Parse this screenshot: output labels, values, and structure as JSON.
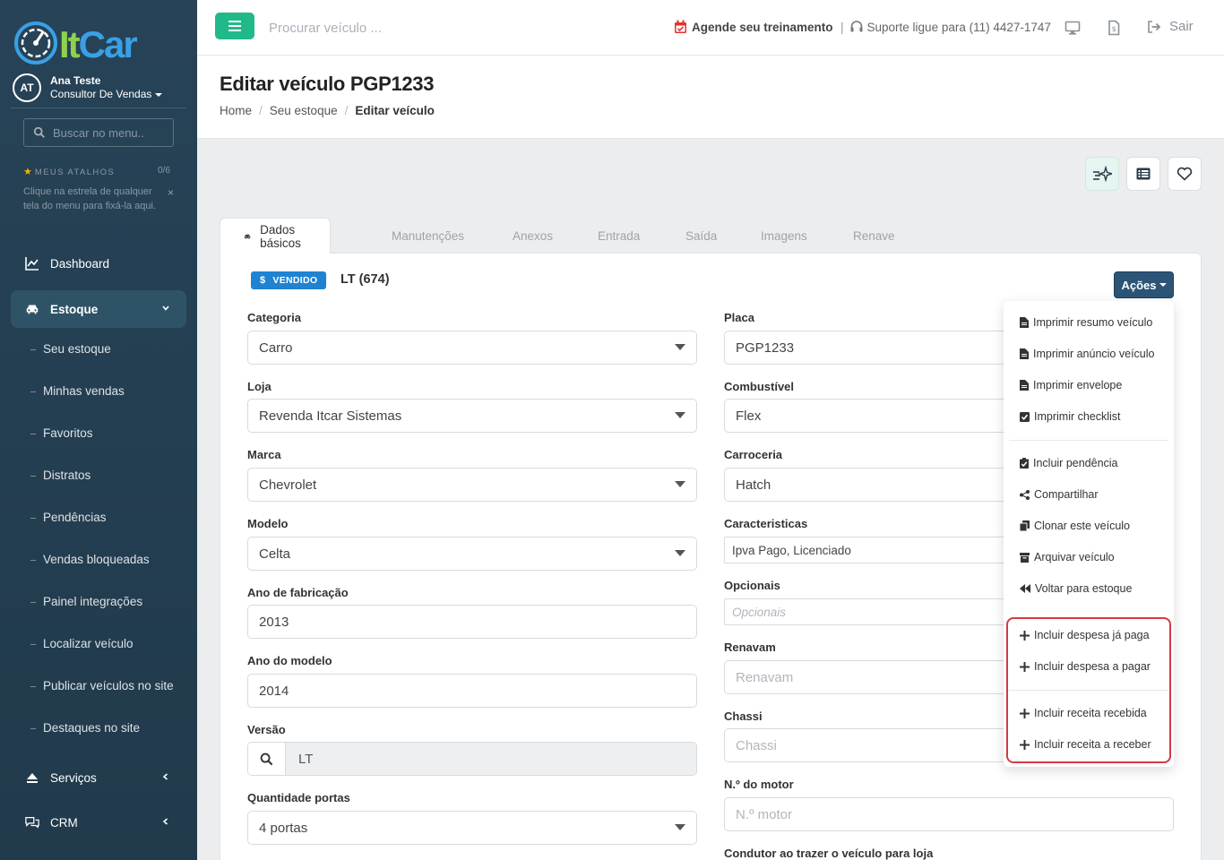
{
  "app": {
    "logo_text_a": "It",
    "logo_text_b": "Car"
  },
  "user": {
    "initials": "AT",
    "name": "Ana Teste",
    "role": "Consultor De Vendas"
  },
  "sidebar": {
    "search_placeholder": "Buscar no menu..",
    "shortcuts_title": "MEUS ATALHOS",
    "shortcuts_count": "0/6",
    "shortcuts_hint": "Clique na estrela de qualquer tela do menu para fixá-la aqui.",
    "nav": [
      {
        "label": "Dashboard"
      },
      {
        "label": "Estoque"
      },
      {
        "label": "Serviços"
      },
      {
        "label": "CRM"
      }
    ],
    "estoque_subitems": [
      {
        "label": "Seu estoque"
      },
      {
        "label": "Minhas vendas"
      },
      {
        "label": "Favoritos"
      },
      {
        "label": "Distratos"
      },
      {
        "label": "Pendências"
      },
      {
        "label": "Vendas bloqueadas"
      },
      {
        "label": "Painel integrações"
      },
      {
        "label": "Localizar veículo"
      },
      {
        "label": "Publicar veículos no site"
      },
      {
        "label": "Destaques no site"
      }
    ]
  },
  "topbar": {
    "search_placeholder": "Procurar veículo ...",
    "training_label": "Agende seu treinamento",
    "separator": "|",
    "support_label": "Suporte ligue para (11) 4427-1747",
    "logout_label": "Sair"
  },
  "header": {
    "title": "Editar veículo PGP1233",
    "breadcrumb": [
      "Home",
      "Seu estoque",
      "Editar veículo"
    ],
    "breadcrumb_sep": "/"
  },
  "tabs": [
    {
      "label": "Dados básicos",
      "active": true
    },
    {
      "label": "Manutenções"
    },
    {
      "label": "Anexos"
    },
    {
      "label": "Entrada"
    },
    {
      "label": "Saída"
    },
    {
      "label": "Imagens"
    },
    {
      "label": "Renave"
    }
  ],
  "vehicle": {
    "status_badge": "VENDIDO",
    "badge_symbol": "$",
    "model_code": "LT (674)"
  },
  "actions_button": "Ações",
  "form_left": {
    "categoria": {
      "label": "Categoria",
      "value": "Carro"
    },
    "loja": {
      "label": "Loja",
      "value": "Revenda Itcar Sistemas"
    },
    "marca": {
      "label": "Marca",
      "value": "Chevrolet"
    },
    "modelo": {
      "label": "Modelo",
      "value": "Celta"
    },
    "ano_fabricacao": {
      "label": "Ano de fabricação",
      "value": "2013"
    },
    "ano_modelo": {
      "label": "Ano do modelo",
      "value": "2014"
    },
    "versao": {
      "label": "Versão",
      "value": "LT"
    },
    "portas": {
      "label": "Quantidade portas",
      "value": "4 portas"
    }
  },
  "form_right": {
    "placa": {
      "label": "Placa",
      "value": "PGP1233"
    },
    "combustivel": {
      "label": "Combustível",
      "value": "Flex"
    },
    "carroceria": {
      "label": "Carroceria",
      "value": "Hatch"
    },
    "caracteristicas": {
      "label": "Caracteristicas",
      "value": "Ipva Pago, Licenciado"
    },
    "opcionais": {
      "label": "Opcionais",
      "placeholder": "Opcionais"
    },
    "renavam": {
      "label": "Renavam",
      "placeholder": "Renavam"
    },
    "chassi": {
      "label": "Chassi",
      "placeholder": "Chassi"
    },
    "motor": {
      "label": "N.º do motor",
      "placeholder": "N.º motor"
    },
    "condutor": {
      "label": "Condutor ao trazer o veículo para loja"
    }
  },
  "actions_menu": {
    "group1": [
      {
        "label": "Imprimir resumo veículo",
        "icon": "file-icon"
      },
      {
        "label": "Imprimir anúncio veículo",
        "icon": "file-icon"
      },
      {
        "label": "Imprimir envelope",
        "icon": "file-icon"
      },
      {
        "label": "Imprimir checklist",
        "icon": "checkbox-icon"
      }
    ],
    "group2": [
      {
        "label": "Incluir pendência",
        "icon": "clipboard-check-icon"
      },
      {
        "label": "Compartilhar",
        "icon": "share-icon"
      },
      {
        "label": "Clonar este veículo",
        "icon": "copy-icon"
      },
      {
        "label": "Arquivar veículo",
        "icon": "archive-icon"
      },
      {
        "label": "Voltar para estoque",
        "icon": "backward-icon"
      }
    ],
    "group3": [
      {
        "label": "Incluir despesa já paga",
        "icon": "plus-icon"
      },
      {
        "label": "Incluir despesa a pagar",
        "icon": "plus-icon"
      }
    ],
    "group4": [
      {
        "label": "Incluir receita recebida",
        "icon": "plus-icon"
      },
      {
        "label": "Incluir receita a receber",
        "icon": "plus-icon"
      }
    ]
  },
  "colors": {
    "sidebar_bg": "#274357",
    "accent_green": "#22b98a",
    "badge_blue": "#1f83d2",
    "actions_button": "#2b5477",
    "highlight_red": "#d33a45"
  }
}
